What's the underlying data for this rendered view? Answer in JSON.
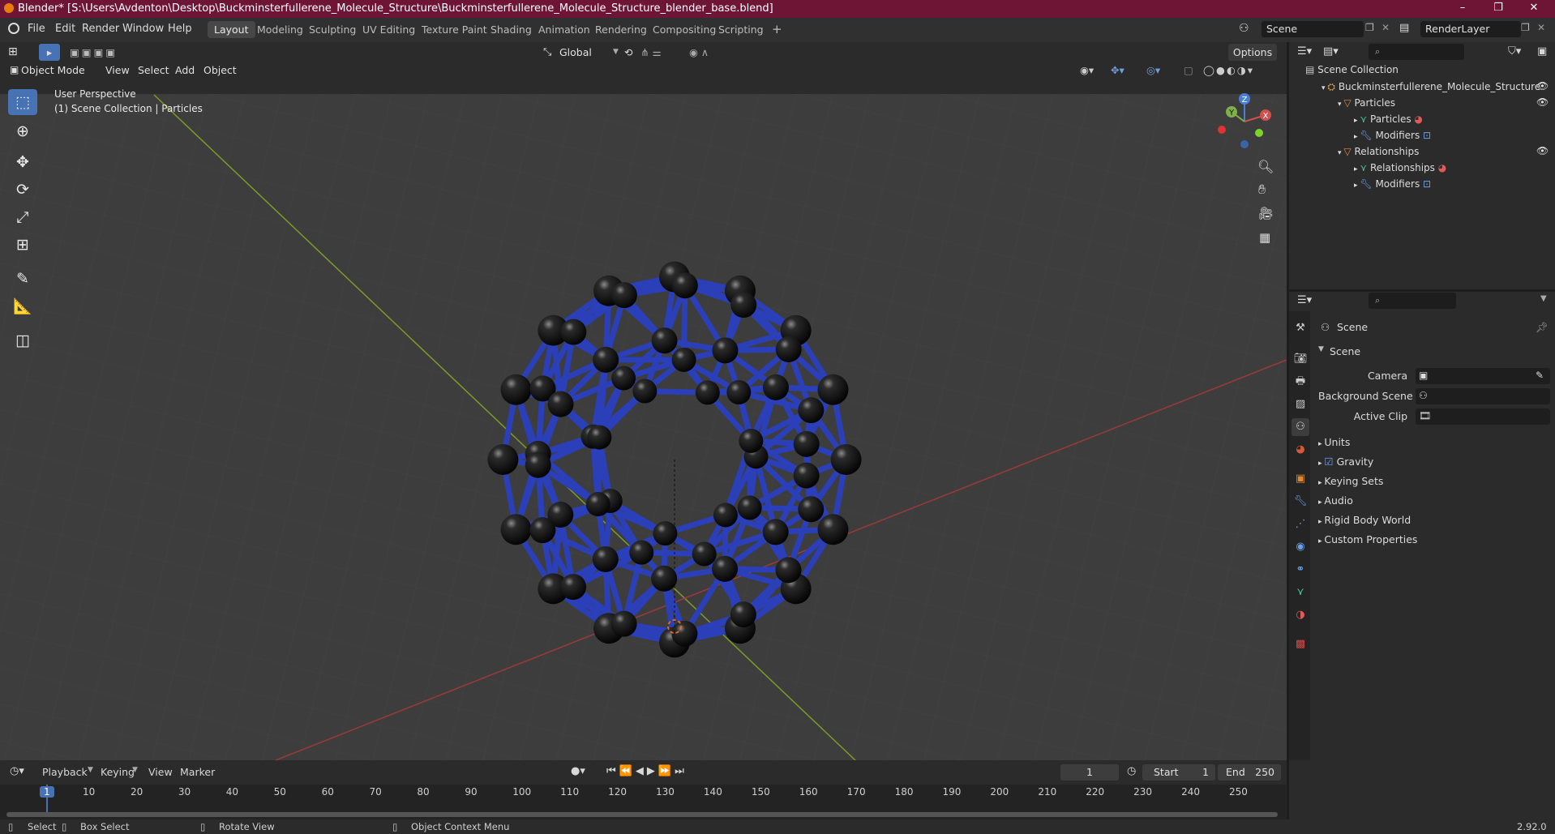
{
  "titlebar": {
    "title": "Blender* [S:\\Users\\Avdenton\\Desktop\\Buckminsterfullerene_Molecule_Structure\\Buckminsterfullerene_Molecule_Structure_blender_base.blend]",
    "minimize": "–",
    "restore": "❐",
    "close": "✕"
  },
  "menubar": {
    "items": [
      "File",
      "Edit",
      "Render",
      "Window",
      "Help"
    ]
  },
  "workspaces": {
    "tabs": [
      "Layout",
      "Modeling",
      "Sculpting",
      "UV Editing",
      "Texture Paint",
      "Shading",
      "Animation",
      "Rendering",
      "Compositing",
      "Scripting"
    ],
    "add": "+"
  },
  "scene_selector": {
    "value": "Scene"
  },
  "renderlayer_selector": {
    "value": "RenderLayer"
  },
  "viewport_header": {
    "transform_orientation": "Global",
    "options": "Options",
    "mode": "Object Mode",
    "menus": [
      "View",
      "Select",
      "Add",
      "Object"
    ]
  },
  "viewport": {
    "perspective_label": "User Perspective",
    "collection_label": "(1) Scene Collection | Particles",
    "gizmo_axes": {
      "x": "X",
      "y": "Y",
      "z": "Z"
    }
  },
  "outliner": {
    "root": "Scene Collection",
    "items": [
      {
        "label": "Buckminsterfullerene_Molecule_Structure",
        "level": 1
      },
      {
        "label": "Particles",
        "level": 2
      },
      {
        "label": "Particles",
        "level": 3
      },
      {
        "label": "Modifiers",
        "level": 3
      },
      {
        "label": "Relationships",
        "level": 2
      },
      {
        "label": "Relationships",
        "level": 3
      },
      {
        "label": "Modifiers",
        "level": 3
      }
    ]
  },
  "properties": {
    "context": "Scene",
    "panel": "Scene",
    "fields": [
      {
        "label": "Camera",
        "value": ""
      },
      {
        "label": "Background Scene",
        "value": ""
      },
      {
        "label": "Active Clip",
        "value": ""
      }
    ],
    "sections": [
      "Units",
      "Gravity",
      "Keying Sets",
      "Audio",
      "Rigid Body World",
      "Custom Properties"
    ],
    "gravity_checked": true
  },
  "timeline": {
    "menus": [
      "Playback",
      "Keying",
      "View",
      "Marker"
    ],
    "current_frame": "1",
    "start_label": "Start",
    "start_value": "1",
    "end_label": "End",
    "end_value": "250",
    "ticks": [
      "1",
      "10",
      "20",
      "30",
      "40",
      "50",
      "60",
      "70",
      "80",
      "90",
      "100",
      "110",
      "120",
      "130",
      "140",
      "150",
      "160",
      "170",
      "180",
      "190",
      "200",
      "210",
      "220",
      "230",
      "240",
      "250"
    ]
  },
  "statusbar": {
    "select": "Select",
    "box_select": "Box Select",
    "rotate_view": "Rotate View",
    "context_menu": "Object Context Menu",
    "version": "2.92.0"
  },
  "colors": {
    "title_bg": "#6e1536",
    "accent": "#4772b3",
    "bond": "#2a3fb8",
    "atom": "#151515"
  }
}
